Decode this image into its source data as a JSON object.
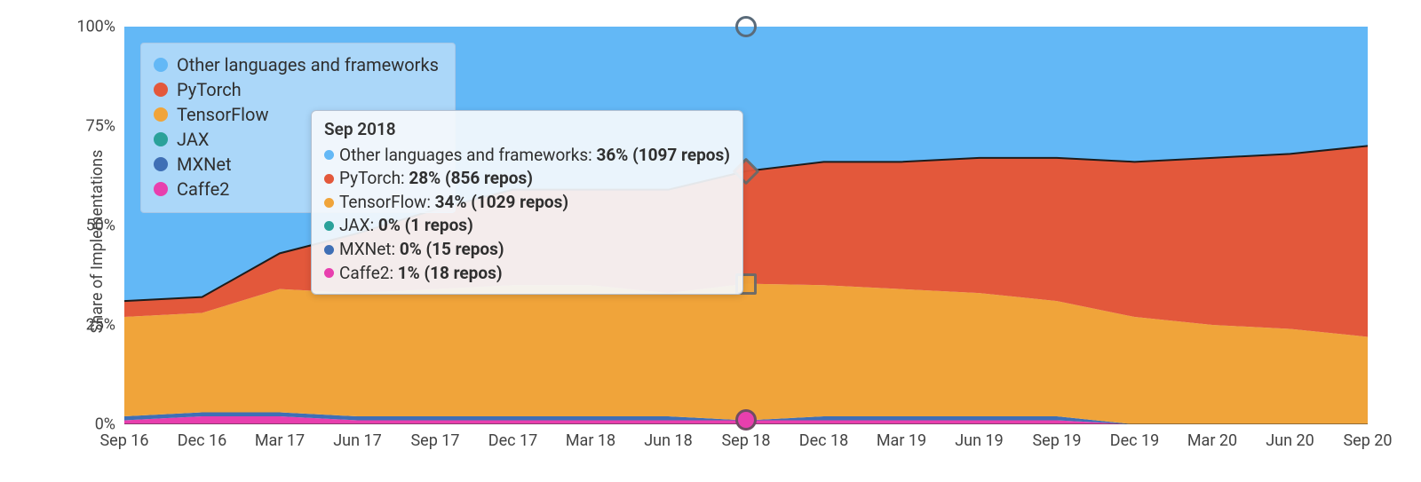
{
  "chart_data": {
    "type": "area",
    "stacked": true,
    "ylabel": "Share of Implementations",
    "xlabel": "",
    "ylim": [
      0,
      100
    ],
    "y_ticks": [
      "0%",
      "25%",
      "50%",
      "75%",
      "100%"
    ],
    "categories": [
      "Sep 16",
      "Dec 16",
      "Mar 17",
      "Jun 17",
      "Sep 17",
      "Dec 17",
      "Mar 18",
      "Jun 18",
      "Sep 18",
      "Dec 18",
      "Mar 19",
      "Jun 19",
      "Sep 19",
      "Dec 19",
      "Mar 20",
      "Jun 20",
      "Sep 20"
    ],
    "series": [
      {
        "name": "Caffe2",
        "color": "#e83fae",
        "values": [
          1,
          2,
          2,
          1,
          1,
          1,
          1,
          1,
          1,
          1,
          1,
          1,
          1,
          0,
          0,
          0,
          0
        ]
      },
      {
        "name": "MXNet",
        "color": "#3f6fb5",
        "values": [
          1,
          1,
          1,
          1,
          1,
          1,
          1,
          1,
          0,
          1,
          1,
          1,
          1,
          0,
          0,
          0,
          0
        ]
      },
      {
        "name": "JAX",
        "color": "#2aa19a",
        "values": [
          0,
          0,
          0,
          0,
          0,
          0,
          0,
          0,
          0,
          0,
          0,
          0,
          0,
          0,
          0,
          0,
          0
        ]
      },
      {
        "name": "TensorFlow",
        "color": "#f0a43a",
        "values": [
          25,
          25,
          31,
          31,
          32,
          33,
          33,
          31,
          34,
          33,
          32,
          31,
          29,
          27,
          25,
          24,
          22
        ]
      },
      {
        "name": "PyTorch",
        "color": "#e3583b",
        "values": [
          4,
          4,
          9,
          15,
          20,
          24,
          24,
          26,
          28,
          31,
          32,
          34,
          36,
          39,
          42,
          44,
          48
        ]
      },
      {
        "name": "Other languages and frameworks",
        "color": "#63b8f6",
        "values": [
          69,
          68,
          57,
          52,
          46,
          41,
          41,
          41,
          36,
          34,
          34,
          33,
          33,
          34,
          33,
          32,
          30
        ]
      }
    ],
    "legend_order": [
      "Other languages and frameworks",
      "PyTorch",
      "TensorFlow",
      "JAX",
      "MXNet",
      "Caffe2"
    ],
    "hover_index": 8,
    "tooltip": {
      "title": "Sep 2018",
      "rows": [
        {
          "color": "#63b8f6",
          "name": "Other languages and frameworks",
          "value": "36% (1097 repos)"
        },
        {
          "color": "#e3583b",
          "name": "PyTorch",
          "value": "28% (856 repos)"
        },
        {
          "color": "#f0a43a",
          "name": "TensorFlow",
          "value": "34% (1029 repos)"
        },
        {
          "color": "#2aa19a",
          "name": "JAX",
          "value": "0% (1 repos)"
        },
        {
          "color": "#3f6fb5",
          "name": "MXNet",
          "value": "0% (15 repos)"
        },
        {
          "color": "#e83fae",
          "name": "Caffe2",
          "value": "1% (18 repos)"
        }
      ]
    }
  },
  "watermark": ""
}
